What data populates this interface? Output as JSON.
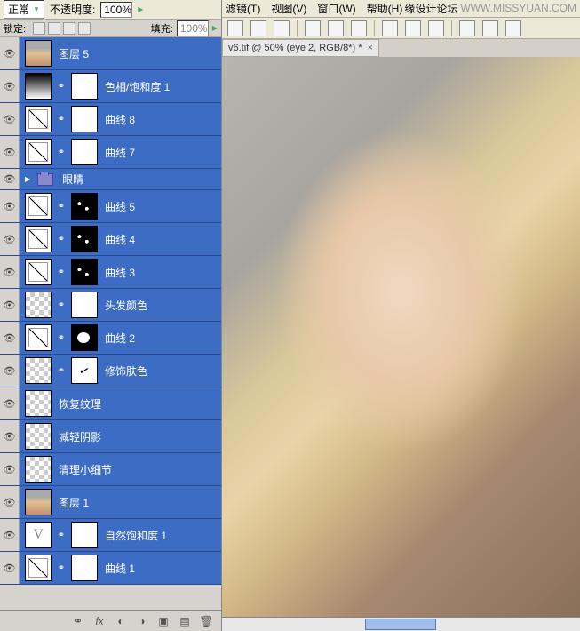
{
  "panel": {
    "blend_mode": "正常",
    "opacity_label": "不透明度:",
    "opacity_value": "100%",
    "lock_label": "锁定:",
    "fill_label": "填充:",
    "fill_value": "100%"
  },
  "layers": [
    {
      "name": "图层 5",
      "type": "pixel",
      "thumb": "photo-thumb",
      "mask": ""
    },
    {
      "name": "色相/饱和度 1",
      "type": "adj",
      "thumb": "grad",
      "mask": "mask-white"
    },
    {
      "name": "曲线 8",
      "type": "adj",
      "thumb": "curves",
      "mask": "mask-white"
    },
    {
      "name": "曲线 7",
      "type": "adj",
      "thumb": "curves",
      "mask": "mask-white"
    },
    {
      "name": "眼睛",
      "type": "group"
    },
    {
      "name": "曲线 5",
      "type": "adj",
      "thumb": "curves",
      "mask": "mask-spots"
    },
    {
      "name": "曲线 4",
      "type": "adj",
      "thumb": "curves",
      "mask": "mask-spots"
    },
    {
      "name": "曲线 3",
      "type": "adj",
      "thumb": "curves",
      "mask": "mask-spots"
    },
    {
      "name": "头发颜色",
      "type": "pixel",
      "thumb": "checker",
      "mask": "mask-white"
    },
    {
      "name": "曲线 2",
      "type": "adj",
      "thumb": "curves",
      "mask": "mask-partial"
    },
    {
      "name": "修饰肤色",
      "type": "pixel",
      "thumb": "checker",
      "mask": "mask-scribble"
    },
    {
      "name": "恢复纹理",
      "type": "pixel",
      "thumb": "checker",
      "mask": ""
    },
    {
      "name": "减轻阴影",
      "type": "pixel",
      "thumb": "checker",
      "mask": ""
    },
    {
      "name": "清理小细节",
      "type": "pixel",
      "thumb": "checker",
      "mask": ""
    },
    {
      "name": "图层 1",
      "type": "pixel",
      "thumb": "photo-thumb",
      "mask": ""
    },
    {
      "name": "自然饱和度 1",
      "type": "adj",
      "thumb": "vibrance",
      "mask": "mask-white"
    },
    {
      "name": "曲线 1",
      "type": "adj",
      "thumb": "curves",
      "mask": "mask-white"
    }
  ],
  "menu": {
    "filter": "滤镜(T)",
    "view": "视图(V)",
    "window": "窗口(W)",
    "help": "帮助(H)",
    "forum": "缘设计论坛",
    "site": "WWW.MISSYUAN.COM"
  },
  "doc_tab": "v6.tif @ 50% (eye 2, RGB/8*) *"
}
